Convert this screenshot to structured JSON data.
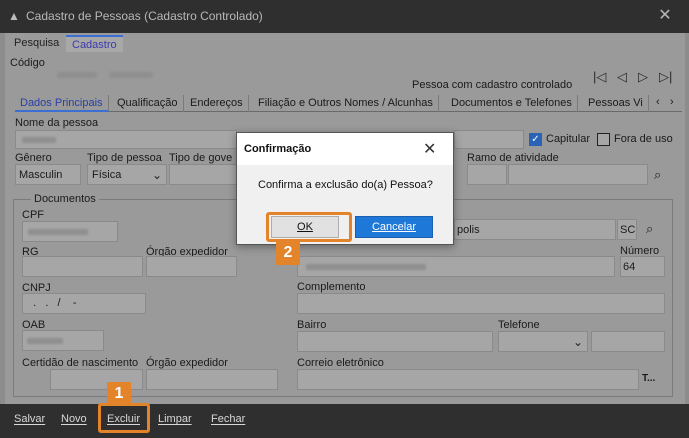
{
  "window": {
    "title": "Cadastro de Pessoas (Cadastro Controlado)",
    "close_glyph": "✕",
    "icon": "app-logo-icon"
  },
  "top_tabs": [
    {
      "label": "Pesquisa"
    },
    {
      "label": "Cadastro"
    }
  ],
  "header": {
    "codigo_label": "Código",
    "controlled_text": "Pessoa com cadastro controlado",
    "nav_icons": [
      "first-record-icon",
      "prev-record-icon",
      "next-record-icon",
      "last-record-icon"
    ]
  },
  "inner_tabs": [
    {
      "label": "Dados Principais"
    },
    {
      "label": "Qualificação"
    },
    {
      "label": "Endereços"
    },
    {
      "label": "Filiação e Outros Nomes / Alcunhas"
    },
    {
      "label": "Documentos e Telefones"
    },
    {
      "label": "Pessoas Vi"
    }
  ],
  "form": {
    "nome_label": "Nome da pessoa",
    "capitular_label": "Capitular",
    "fora_de_uso_label": "Fora de uso",
    "genero_label": "Gênero",
    "genero_value": "Masculin",
    "tipo_pessoa_label": "Tipo de pessoa",
    "tipo_pessoa_value": "Física",
    "tipo_governo_label": "Tipo de gove",
    "ramo_label": "Ramo de atividade",
    "documentos_label": "Documentos",
    "cpf_label": "CPF",
    "rg_label": "RG",
    "orgao_expedidor_label": "Órgão expedidor",
    "cnpj_label": "CNPJ",
    "cnpj_value": "  .   .   /    -",
    "oab_label": "OAB",
    "certidao_label": "Certidão de nascimento",
    "orgao_expedidor2_label": "Órgão expedidor",
    "cidade_value": "polis",
    "uf_value": "SC",
    "numero_label": "Número",
    "numero_value": "64",
    "complemento_label": "Complemento",
    "bairro_label": "Bairro",
    "telefone_label": "Telefone",
    "correio_label": "Correio eletrônico",
    "email_trailing": "T..."
  },
  "bottom_bar": [
    {
      "label": "Salvar"
    },
    {
      "label": "Novo"
    },
    {
      "label": "Excluir"
    },
    {
      "label": "Limpar"
    },
    {
      "label": "Fechar"
    }
  ],
  "dialog": {
    "title": "Confirmação",
    "message": "Confirma a exclusão do(a) Pessoa?",
    "ok_label": "OK",
    "cancel_label": "Cancelar"
  },
  "annotations": {
    "step1": "1",
    "step2": "2",
    "color": "#e3832a"
  }
}
